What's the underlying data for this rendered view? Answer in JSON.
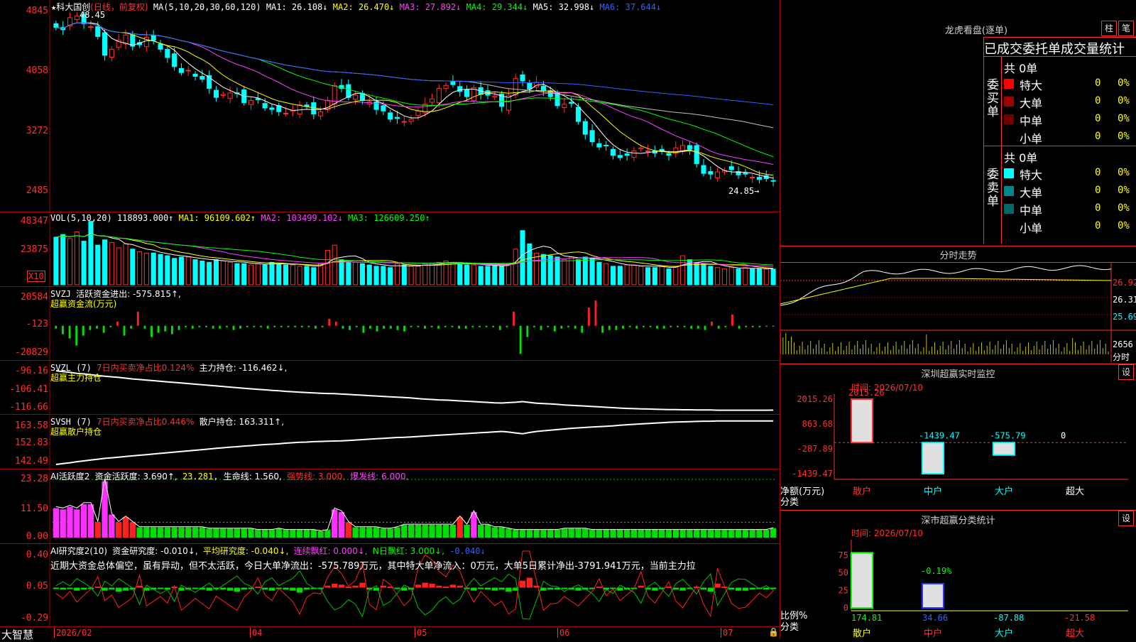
{
  "window": {
    "title": "大智慧"
  },
  "header": {
    "star": "★",
    "stock_name": "科大国创",
    "mode": "(日线，前复权)",
    "ma_params": "MA(5,10,20,30,60,120)",
    "ma_values": [
      "MA1: 26.108↓",
      "MA2: 26.470↓",
      "MA3: 27.892↓",
      "MA4: 29.344↓",
      "MA5: 32.998↓",
      "MA6: 37.644↓"
    ],
    "ma_colors": [
      "#ffffff",
      "#ffff00",
      "#ff40ff",
      "#00ff00",
      "#c0c0c0",
      "#3060ff"
    ]
  },
  "price_pane": {
    "yticks": [
      "4845",
      "4058",
      "3272",
      "2485"
    ],
    "high_label": "48.45",
    "low_label": "24.85→"
  },
  "vol_pane": {
    "title": "VOL(5,10,20)",
    "value": "118893.000↑",
    "ma1": "MA1: 96109.602↑",
    "ma2": "MA2: 103499.102↓",
    "ma3": "MA3: 126609.250↑",
    "yticks": [
      "48347",
      "23875"
    ],
    "unit": "X10"
  },
  "svzj_pane": {
    "title": "SVZJ",
    "active": "活跃资金进出: -575.815↑,",
    "subtitle": "超赢资金流(万元)",
    "yticks": [
      "20584",
      "-123",
      "-20829"
    ]
  },
  "svzl_pane": {
    "title": "SVZL (7)",
    "ratio": "7日内买卖净占比0.124%",
    "hold": "主力持仓: -116.462↓,",
    "subtitle": "超赢主力持仓",
    "yticks": [
      "-96.16",
      "-106.41",
      "-116.66"
    ]
  },
  "svsh_pane": {
    "title": "SVSH (7)",
    "ratio": "7日内买卖净占比0.446%",
    "hold": "散户持仓: 163.311↑,",
    "subtitle": "超赢散户持仓",
    "yticks": [
      "163.58",
      "152.83",
      "142.49"
    ]
  },
  "ai_active_pane": {
    "title": "AI活跃度2",
    "activity": "资金活跃度: 3.690↑,",
    "v2": "23.281,",
    "life": "生命线: 1.560,",
    "strong": "强势线: 3.000,",
    "burst": "爆发线: 6.000,",
    "yticks": [
      "23.28",
      "11.50",
      "0.00"
    ]
  },
  "ai_research_pane": {
    "title": "AI研究度2(10)",
    "research": "资金研究度: -0.010↓,",
    "avg": "平均研究度: -0.040↓,",
    "cont": "连续飘红: 0.000↓,",
    "nday": "N日飘红: 3.000↓,",
    "last": "-0.040↓",
    "comment": "近期大资金总体偏空，虽有异动，但不太活跃，今日大单净流出：-575.789万元，其中特大单净流入：0万元，大单5日累计净出-3791.941万元，当前主力拉",
    "yticks": [
      "0.40",
      "0.05",
      "-0.29"
    ]
  },
  "xaxis": {
    "labels": [
      "2026/02",
      "04",
      "05",
      "06",
      "07"
    ]
  },
  "lhb": {
    "title": "龙虎看盘(逐单)",
    "btn_zhu": "柱",
    "btn_bi": "笔",
    "header": "已成交委托单成交量统计",
    "buy_side": "委买单",
    "sell_side": "委卖单",
    "buy_total": "共 0单",
    "sell_total": "共 0单",
    "rows": [
      {
        "name": "特大",
        "vol": "0",
        "pct": "0%"
      },
      {
        "name": "大单",
        "vol": "0",
        "pct": "0%"
      },
      {
        "name": "中单",
        "vol": "0",
        "pct": "0%"
      },
      {
        "name": "小单",
        "vol": "0",
        "pct": "0%"
      }
    ],
    "buy_colors": [
      "#ff0000",
      "#a00000",
      "#700000",
      "#000000"
    ],
    "sell_colors": [
      "#00ffff",
      "#008888",
      "#006868",
      "#000000"
    ]
  },
  "intraday": {
    "title": "分时走势",
    "yticks": [
      "26.92",
      "26.31",
      "25.69"
    ],
    "vol_label": "2656",
    "unit": "分时"
  },
  "sz_monitor": {
    "title": "深圳超赢实时监控",
    "btn": "设",
    "time": "时间: 2026/07/10",
    "yticks": [
      "2015.26",
      "863.68",
      "-287.89",
      "-1439.47"
    ],
    "ylabel": "净额(万元)",
    "xlabel": "分类",
    "categories": [
      "散户",
      "中户",
      "大户",
      "超大"
    ],
    "value_labels": [
      "2015.26",
      "-1439.47",
      "-575.79",
      "0"
    ]
  },
  "sz_class": {
    "title": "深市超赢分类统计",
    "btn": "设",
    "time": "时间: 2026/07/10",
    "yticks": [
      "75",
      "50",
      "25",
      "0"
    ],
    "ylabel": "比例%",
    "xlabel": "分类",
    "categories": [
      "散户",
      "中户",
      "大户",
      "超大"
    ],
    "pct_label": "-0.19%",
    "value_labels": [
      "174.81",
      "34.66",
      "-87.88",
      "-21.58"
    ]
  },
  "chart_data": [
    {
      "type": "candlestick",
      "title": "科大国创 (日线，前复权)",
      "ylim": [
        24.85,
        48.45
      ],
      "x": [
        "2026/02",
        "04",
        "05",
        "06",
        "07"
      ],
      "close": [
        46.5,
        46.2,
        47.8,
        48.0,
        47.0,
        46.6,
        45.3,
        42.8,
        43.6,
        44.8,
        45.5,
        44.0,
        44.2,
        45.2,
        44.8,
        43.6,
        42.5,
        41.3,
        40.5,
        40.8,
        40.0,
        39.6,
        38.4,
        37.2,
        37.6,
        37.8,
        37.7,
        36.5,
        36.8,
        36.9,
        35.8,
        35.6,
        35.3,
        35.1,
        35.5,
        36.2,
        36.0,
        35.0,
        35.3,
        36.8,
        38.8,
        38.4,
        37.2,
        37.5,
        36.8,
        36.6,
        35.6,
        35.4,
        34.3,
        34.4,
        34.0,
        34.3,
        35.4,
        36.3,
        37.0,
        38.4,
        38.8,
        38.9,
        38.0,
        37.3,
        38.5,
        37.6,
        37.5,
        37.4,
        36.0,
        37.5,
        39.7,
        39.4,
        38.3,
        39.2,
        38.1,
        37.3,
        36.1,
        36.3,
        36.4,
        34.0,
        32.3,
        31.3,
        30.6,
        30.8,
        29.5,
        29.2,
        29.5,
        30.1,
        30.5,
        30.1,
        29.8,
        30.0,
        29.5,
        30.5,
        30.8,
        30.3,
        28.4,
        27.1,
        27.0,
        27.3,
        27.5,
        27.6,
        26.9,
        27.0,
        26.6,
        26.3,
        26.4,
        26.1
      ],
      "ma_series": [
        {
          "name": "MA1",
          "color": "#ffffff"
        },
        {
          "name": "MA2",
          "color": "#ffff00"
        },
        {
          "name": "MA3",
          "color": "#ff40ff"
        },
        {
          "name": "MA4",
          "color": "#00ff00"
        },
        {
          "name": "MA5",
          "color": "#c0c0c0"
        },
        {
          "name": "MA6",
          "color": "#3060ff"
        }
      ]
    },
    {
      "type": "bar",
      "title": "VOL(5,10,20)",
      "unit": "X10",
      "ylim": [
        0,
        48347
      ],
      "values": [
        36000,
        38000,
        35000,
        40000,
        33000,
        48000,
        30000,
        34000,
        32000,
        28000,
        31000,
        27000,
        25000,
        24000,
        24000,
        23000,
        22000,
        20000,
        21000,
        21000,
        19000,
        18000,
        17000,
        19000,
        18000,
        17000,
        16000,
        16000,
        15000,
        16000,
        15000,
        17000,
        16000,
        15000,
        15000,
        14000,
        14000,
        13000,
        16000,
        26000,
        30000,
        19000,
        17000,
        17000,
        16000,
        15000,
        14000,
        14000,
        13000,
        16000,
        15000,
        14000,
        14000,
        16000,
        16000,
        17000,
        18000,
        17000,
        16000,
        15000,
        15000,
        14000,
        14000,
        15000,
        14000,
        16000,
        27000,
        41000,
        31000,
        24000,
        23000,
        22000,
        21000,
        19000,
        21000,
        19000,
        21000,
        20000,
        17000,
        16000,
        14000,
        14000,
        15000,
        15000,
        14000,
        13000,
        13000,
        14000,
        12000,
        14000,
        22000,
        19000,
        17000,
        16000,
        14000,
        13000,
        12000,
        13000,
        12000,
        13000,
        12000,
        12000,
        11890,
        11890
      ]
    },
    {
      "type": "bar",
      "title": "超赢资金流(万元)",
      "ylim": [
        -20829,
        20584
      ],
      "values": [
        -2000,
        -6000,
        -9000,
        -14000,
        -7000,
        -3000,
        -2000,
        -5000,
        -1000,
        3000,
        -7000,
        -2000,
        10000,
        -2000,
        -8000,
        -5000,
        -4000,
        -6000,
        -3000,
        -1000,
        -2000,
        -1000,
        -1000,
        -2000,
        -2000,
        -1000,
        -3000,
        -2000,
        -1000,
        -1000,
        -1000,
        -2000,
        -1000,
        -1000,
        -1000,
        -1000,
        -1000,
        -1000,
        -2000,
        -1000,
        5000,
        3000,
        -2000,
        -3000,
        -1000,
        -5000,
        -2000,
        -4000,
        -2000,
        -2000,
        -3000,
        -4000,
        -1000,
        -1000,
        -2000,
        -1000,
        -2000,
        -1000,
        -1000,
        -2000,
        -2000,
        -1000,
        -1000,
        -1000,
        -1000,
        -3000,
        -1000,
        10000,
        -20000,
        -8000,
        -1000,
        -3000,
        -1000,
        -4000,
        -2000,
        -1000,
        -2000,
        -5000,
        13000,
        18000,
        -5000,
        -3000,
        -3000,
        -2000,
        -1000,
        -2000,
        -1000,
        -1000,
        -2000,
        -2000,
        -1000,
        -1000,
        -1000,
        -2000,
        -2000,
        -3000,
        3000,
        -2000,
        -1000,
        8000,
        -2000,
        -1000,
        -1000,
        -1000,
        -576,
        -576
      ]
    },
    {
      "type": "line",
      "title": "超赢主力持仓",
      "ylim": [
        -116.66,
        -96.16
      ],
      "values": [
        -96.2,
        -96.6,
        -97.0,
        -97.5,
        -97.8,
        -98.2,
        -98.6,
        -99.0,
        -99.3,
        -99.6,
        -100.0,
        -100.4,
        -100.7,
        -101.0,
        -101.3,
        -101.6,
        -101.9,
        -102.2,
        -102.5,
        -102.8,
        -103.1,
        -103.4,
        -103.7,
        -104.0,
        -104.3,
        -104.6,
        -104.9,
        -105.2,
        -105.5,
        -105.8,
        -106.0,
        -106.3,
        -106.5,
        -106.8,
        -107.0,
        -107.2,
        -107.4,
        -107.6,
        -107.8,
        -107.9,
        -108.0,
        -108.2,
        -108.4,
        -108.6,
        -108.8,
        -109.0,
        -109.2,
        -109.4,
        -109.6,
        -109.8,
        -110.0,
        -110.2,
        -110.5,
        -110.8,
        -111.0,
        -111.2,
        -111.3,
        -111.5,
        -111.7,
        -111.9,
        -112.1,
        -112.3,
        -112.5,
        -112.7,
        -112.8,
        -112.6,
        -112.4,
        -112.1,
        -112.5,
        -112.9,
        -113.1,
        -113.3,
        -113.5,
        -113.8,
        -114.0,
        -114.2,
        -114.4,
        -114.6,
        -114.8,
        -115.0,
        -115.2,
        -115.4,
        -115.6,
        -115.7,
        -115.8,
        -115.9,
        -116.0,
        -116.1,
        -116.2,
        -116.2,
        -116.3,
        -116.3,
        -116.4,
        -116.4,
        -116.4,
        -116.5,
        -116.5,
        -116.5,
        -116.5,
        -116.5,
        -116.5,
        -116.5,
        -116.5,
        -116.46
      ]
    },
    {
      "type": "line",
      "title": "超赢散户持仓",
      "ylim": [
        142.49,
        163.58
      ],
      "values": [
        142.5,
        142.9,
        143.3,
        143.8,
        144.2,
        144.6,
        145.0,
        145.4,
        145.7,
        146.0,
        146.3,
        146.6,
        146.9,
        147.2,
        147.5,
        147.8,
        148.1,
        148.4,
        148.7,
        149.0,
        149.3,
        149.6,
        149.9,
        150.2,
        150.5,
        150.8,
        151.0,
        151.3,
        151.5,
        151.8,
        152.0,
        152.2,
        152.4,
        152.7,
        152.9,
        153.1,
        153.2,
        153.4,
        153.5,
        153.6,
        153.7,
        153.8,
        154.0,
        154.2,
        154.4,
        154.6,
        154.8,
        155.0,
        155.2,
        155.4,
        155.5,
        155.7,
        155.9,
        156.1,
        156.3,
        156.5,
        156.7,
        156.9,
        157.1,
        157.3,
        157.5,
        157.7,
        157.9,
        158.1,
        158.3,
        158.0,
        157.6,
        157.2,
        157.8,
        158.3,
        158.6,
        158.9,
        159.2,
        159.5,
        159.8,
        160.0,
        160.2,
        160.4,
        160.6,
        160.8,
        161.0,
        161.3,
        161.5,
        161.7,
        161.9,
        162.1,
        162.3,
        162.5,
        162.7,
        162.8,
        162.9,
        163.0,
        163.1,
        163.2,
        163.2,
        163.3,
        163.3,
        163.3,
        163.3,
        163.3,
        163.3,
        163.3,
        163.3,
        163.31
      ]
    },
    {
      "type": "bar",
      "title": "AI活跃度2",
      "ylim": [
        0,
        23.28
      ],
      "reference_lines": [
        {
          "name": "强势线",
          "value": 3.0
        },
        {
          "name": "爆发线",
          "value": 6.0
        }
      ],
      "values": [
        11.5,
        11.0,
        12.0,
        11.0,
        13.0,
        13.0,
        6.0,
        22.0,
        9.0,
        6.0,
        8.0,
        6.0,
        4.0,
        4.0,
        4.0,
        4.0,
        4.0,
        4.0,
        4.0,
        4.0,
        4.0,
        4.0,
        3.5,
        3.5,
        3.5,
        3.5,
        3.5,
        3.5,
        3.5,
        3.0,
        3.0,
        3.0,
        3.5,
        3.0,
        3.0,
        3.0,
        3.0,
        3.0,
        2.5,
        3.0,
        11.0,
        10.0,
        6.0,
        4.0,
        4.0,
        4.0,
        4.0,
        3.5,
        3.5,
        4.0,
        5.0,
        5.0,
        5.0,
        5.0,
        5.0,
        5.0,
        5.0,
        5.0,
        8.0,
        5.0,
        10.0,
        5.0,
        5.0,
        4.0,
        4.0,
        3.5,
        3.0,
        3.0,
        3.0,
        3.0,
        3.0,
        3.0,
        3.0,
        3.5,
        3.5,
        3.5,
        3.5,
        3.0,
        3.0,
        3.0,
        3.0,
        3.0,
        3.0,
        3.0,
        3.0,
        3.0,
        3.0,
        3.0,
        3.0,
        3.0,
        3.0,
        3.0,
        3.0,
        3.0,
        3.0,
        3.0,
        3.0,
        3.0,
        3.0,
        3.0,
        3.0,
        3.0,
        3.0,
        3.69
      ]
    },
    {
      "type": "bar",
      "title": "AI研究度2(10)",
      "ylim": [
        -0.29,
        0.4
      ],
      "values": [
        -0.01,
        -0.02,
        -0.01,
        -0.03,
        -0.02,
        -0.01,
        0.01,
        -0.03,
        -0.02,
        -0.04,
        -0.03,
        -0.02,
        0.02,
        -0.03,
        -0.02,
        -0.01,
        -0.02,
        0.01,
        -0.03,
        -0.02,
        -0.01,
        -0.02,
        -0.03,
        -0.01,
        -0.02,
        -0.03,
        -0.04,
        -0.02,
        -0.01,
        0.01,
        -0.02,
        -0.03,
        -0.01,
        -0.02,
        -0.03,
        -0.05,
        -0.02,
        -0.01,
        -0.01,
        0.02,
        0.04,
        0.03,
        0.01,
        0.02,
        0.05,
        -0.02,
        -0.03,
        0.02,
        0.01,
        -0.01,
        -0.03,
        -0.02,
        0.03,
        0.05,
        0.04,
        0.02,
        0.01,
        0.03,
        0.02,
        -0.01,
        -0.03,
        -0.01,
        -0.02,
        -0.03,
        -0.02,
        -0.04,
        -0.03,
        0.07,
        0.1,
        0.02,
        -0.03,
        -0.02,
        -0.02,
        -0.01,
        -0.02,
        -0.03,
        -0.02,
        -0.01,
        0.01,
        -0.02,
        -0.01,
        -0.03,
        -0.02,
        -0.01,
        0.02,
        -0.02,
        -0.03,
        -0.01,
        0.01,
        -0.02,
        -0.03,
        -0.01,
        0.01,
        -0.02,
        -0.04,
        0.04,
        0.01,
        -0.02,
        -0.03,
        -0.03,
        -0.02,
        -0.01,
        -0.02,
        -0.01
      ]
    },
    {
      "type": "bar",
      "title": "深圳超赢实时监控",
      "categories": [
        "散户",
        "中户",
        "大户",
        "超大"
      ],
      "values": [
        2015.26,
        -1439.47,
        -575.79,
        0
      ],
      "ylim": [
        -1439.47,
        2015.26
      ]
    },
    {
      "type": "bar",
      "title": "深市超赢分类统计",
      "categories": [
        "散户",
        "中户",
        "大户",
        "超大"
      ],
      "values": [
        174.81,
        34.66,
        -87.88,
        -21.58
      ],
      "ylim": [
        0,
        75
      ]
    }
  ]
}
